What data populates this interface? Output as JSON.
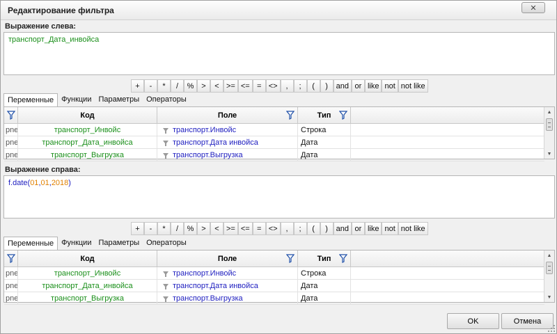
{
  "window": {
    "title": "Редактирование фильтра",
    "close_glyph": "✕"
  },
  "left": {
    "label": "Выражение слева:",
    "expression": "транспорт_Дата_инвойса"
  },
  "right": {
    "label": "Выражение справа:",
    "fn": "f.date(",
    "arg1": "01",
    "arg2": "01",
    "arg3": "2018",
    "comma": ",",
    "close": ")"
  },
  "operators": [
    "+",
    "-",
    "*",
    "/",
    "%",
    ">",
    "<",
    ">=",
    "<=",
    "=",
    "<>",
    ",",
    ";",
    "(",
    ")",
    "and",
    "or",
    "like",
    "not",
    "not like"
  ],
  "tabs": [
    "Переменные",
    "Функции",
    "Параметры",
    "Операторы"
  ],
  "grid": {
    "columns": {
      "code": "Код",
      "field": "Поле",
      "type": "Тип"
    },
    "rows": [
      {
        "first": "pne",
        "code": "транспорт_Инвойс",
        "field": "транспорт.Инвойс",
        "type": "Строка"
      },
      {
        "first": "pne",
        "code": "транспорт_Дата_инвойса",
        "field": "транспорт.Дата инвойса",
        "type": "Дата"
      },
      {
        "first": "pne",
        "code": "транспорт_Выгрузка",
        "field": "транспорт.Выгрузка",
        "type": "Дата"
      }
    ]
  },
  "buttons": {
    "ok": "OK",
    "cancel": "Отмена"
  },
  "icons": {
    "filter": "funnel-icon",
    "field": "field-icon",
    "close": "close-icon"
  },
  "colors": {
    "code_text": "#1a8f1a",
    "field_text": "#2020c0",
    "number_text": "#e08000"
  }
}
